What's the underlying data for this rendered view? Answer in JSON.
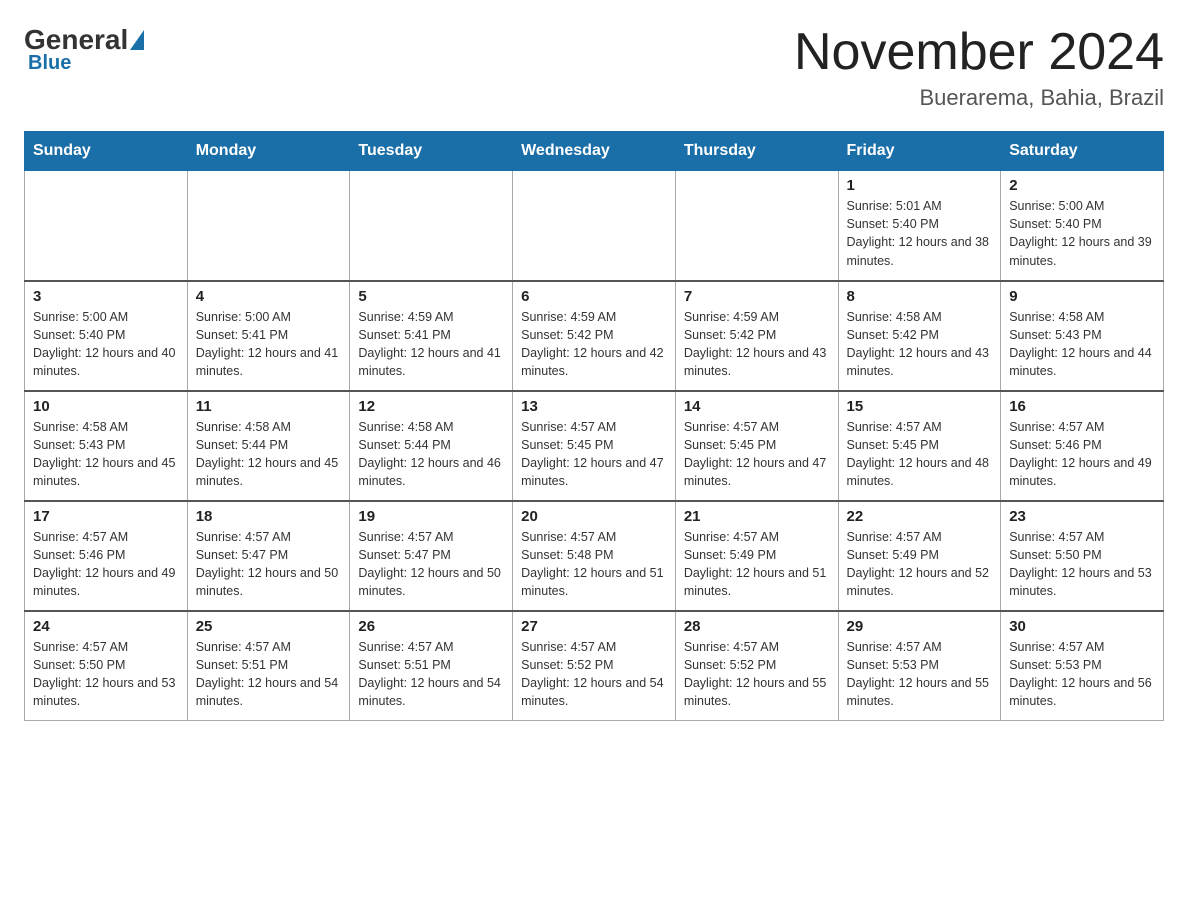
{
  "header": {
    "logo": {
      "general": "General",
      "blue": "Blue"
    },
    "title": "November 2024",
    "location": "Buerarema, Bahia, Brazil"
  },
  "calendar": {
    "days_of_week": [
      "Sunday",
      "Monday",
      "Tuesday",
      "Wednesday",
      "Thursday",
      "Friday",
      "Saturday"
    ],
    "weeks": [
      [
        {
          "day": "",
          "info": ""
        },
        {
          "day": "",
          "info": ""
        },
        {
          "day": "",
          "info": ""
        },
        {
          "day": "",
          "info": ""
        },
        {
          "day": "",
          "info": ""
        },
        {
          "day": "1",
          "info": "Sunrise: 5:01 AM\nSunset: 5:40 PM\nDaylight: 12 hours and 38 minutes."
        },
        {
          "day": "2",
          "info": "Sunrise: 5:00 AM\nSunset: 5:40 PM\nDaylight: 12 hours and 39 minutes."
        }
      ],
      [
        {
          "day": "3",
          "info": "Sunrise: 5:00 AM\nSunset: 5:40 PM\nDaylight: 12 hours and 40 minutes."
        },
        {
          "day": "4",
          "info": "Sunrise: 5:00 AM\nSunset: 5:41 PM\nDaylight: 12 hours and 41 minutes."
        },
        {
          "day": "5",
          "info": "Sunrise: 4:59 AM\nSunset: 5:41 PM\nDaylight: 12 hours and 41 minutes."
        },
        {
          "day": "6",
          "info": "Sunrise: 4:59 AM\nSunset: 5:42 PM\nDaylight: 12 hours and 42 minutes."
        },
        {
          "day": "7",
          "info": "Sunrise: 4:59 AM\nSunset: 5:42 PM\nDaylight: 12 hours and 43 minutes."
        },
        {
          "day": "8",
          "info": "Sunrise: 4:58 AM\nSunset: 5:42 PM\nDaylight: 12 hours and 43 minutes."
        },
        {
          "day": "9",
          "info": "Sunrise: 4:58 AM\nSunset: 5:43 PM\nDaylight: 12 hours and 44 minutes."
        }
      ],
      [
        {
          "day": "10",
          "info": "Sunrise: 4:58 AM\nSunset: 5:43 PM\nDaylight: 12 hours and 45 minutes."
        },
        {
          "day": "11",
          "info": "Sunrise: 4:58 AM\nSunset: 5:44 PM\nDaylight: 12 hours and 45 minutes."
        },
        {
          "day": "12",
          "info": "Sunrise: 4:58 AM\nSunset: 5:44 PM\nDaylight: 12 hours and 46 minutes."
        },
        {
          "day": "13",
          "info": "Sunrise: 4:57 AM\nSunset: 5:45 PM\nDaylight: 12 hours and 47 minutes."
        },
        {
          "day": "14",
          "info": "Sunrise: 4:57 AM\nSunset: 5:45 PM\nDaylight: 12 hours and 47 minutes."
        },
        {
          "day": "15",
          "info": "Sunrise: 4:57 AM\nSunset: 5:45 PM\nDaylight: 12 hours and 48 minutes."
        },
        {
          "day": "16",
          "info": "Sunrise: 4:57 AM\nSunset: 5:46 PM\nDaylight: 12 hours and 49 minutes."
        }
      ],
      [
        {
          "day": "17",
          "info": "Sunrise: 4:57 AM\nSunset: 5:46 PM\nDaylight: 12 hours and 49 minutes."
        },
        {
          "day": "18",
          "info": "Sunrise: 4:57 AM\nSunset: 5:47 PM\nDaylight: 12 hours and 50 minutes."
        },
        {
          "day": "19",
          "info": "Sunrise: 4:57 AM\nSunset: 5:47 PM\nDaylight: 12 hours and 50 minutes."
        },
        {
          "day": "20",
          "info": "Sunrise: 4:57 AM\nSunset: 5:48 PM\nDaylight: 12 hours and 51 minutes."
        },
        {
          "day": "21",
          "info": "Sunrise: 4:57 AM\nSunset: 5:49 PM\nDaylight: 12 hours and 51 minutes."
        },
        {
          "day": "22",
          "info": "Sunrise: 4:57 AM\nSunset: 5:49 PM\nDaylight: 12 hours and 52 minutes."
        },
        {
          "day": "23",
          "info": "Sunrise: 4:57 AM\nSunset: 5:50 PM\nDaylight: 12 hours and 53 minutes."
        }
      ],
      [
        {
          "day": "24",
          "info": "Sunrise: 4:57 AM\nSunset: 5:50 PM\nDaylight: 12 hours and 53 minutes."
        },
        {
          "day": "25",
          "info": "Sunrise: 4:57 AM\nSunset: 5:51 PM\nDaylight: 12 hours and 54 minutes."
        },
        {
          "day": "26",
          "info": "Sunrise: 4:57 AM\nSunset: 5:51 PM\nDaylight: 12 hours and 54 minutes."
        },
        {
          "day": "27",
          "info": "Sunrise: 4:57 AM\nSunset: 5:52 PM\nDaylight: 12 hours and 54 minutes."
        },
        {
          "day": "28",
          "info": "Sunrise: 4:57 AM\nSunset: 5:52 PM\nDaylight: 12 hours and 55 minutes."
        },
        {
          "day": "29",
          "info": "Sunrise: 4:57 AM\nSunset: 5:53 PM\nDaylight: 12 hours and 55 minutes."
        },
        {
          "day": "30",
          "info": "Sunrise: 4:57 AM\nSunset: 5:53 PM\nDaylight: 12 hours and 56 minutes."
        }
      ]
    ]
  }
}
